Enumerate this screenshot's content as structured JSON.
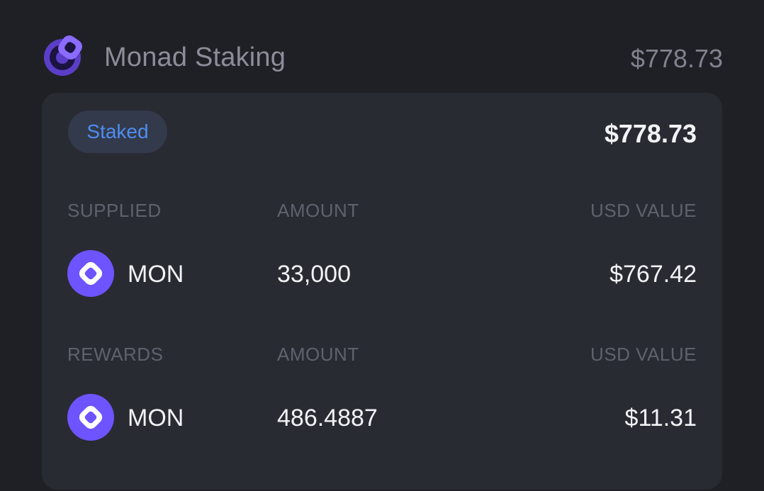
{
  "header": {
    "logo_icon": "monad-staking-logo-icon",
    "protocol_name": "Monad Staking",
    "total_value": "$778.73"
  },
  "card": {
    "badge": "Staked",
    "total_value": "$778.73",
    "supplied": {
      "headers": {
        "label": "SUPPLIED",
        "amount": "AMOUNT",
        "usd": "USD VALUE"
      },
      "token": {
        "icon": "mon-token-icon",
        "symbol": "MON",
        "amount": "33,000",
        "usd": "$767.42"
      }
    },
    "rewards": {
      "headers": {
        "label": "REWARDS",
        "amount": "AMOUNT",
        "usd": "USD VALUE"
      },
      "token": {
        "icon": "mon-token-icon",
        "symbol": "MON",
        "amount": "486.4887",
        "usd": "$11.31"
      }
    }
  },
  "colors": {
    "background": "#1f2026",
    "card": "#292b33",
    "badge_bg": "#333a4c",
    "badge_text": "#4f8ef0",
    "monad_purple": "#6e54ff"
  }
}
